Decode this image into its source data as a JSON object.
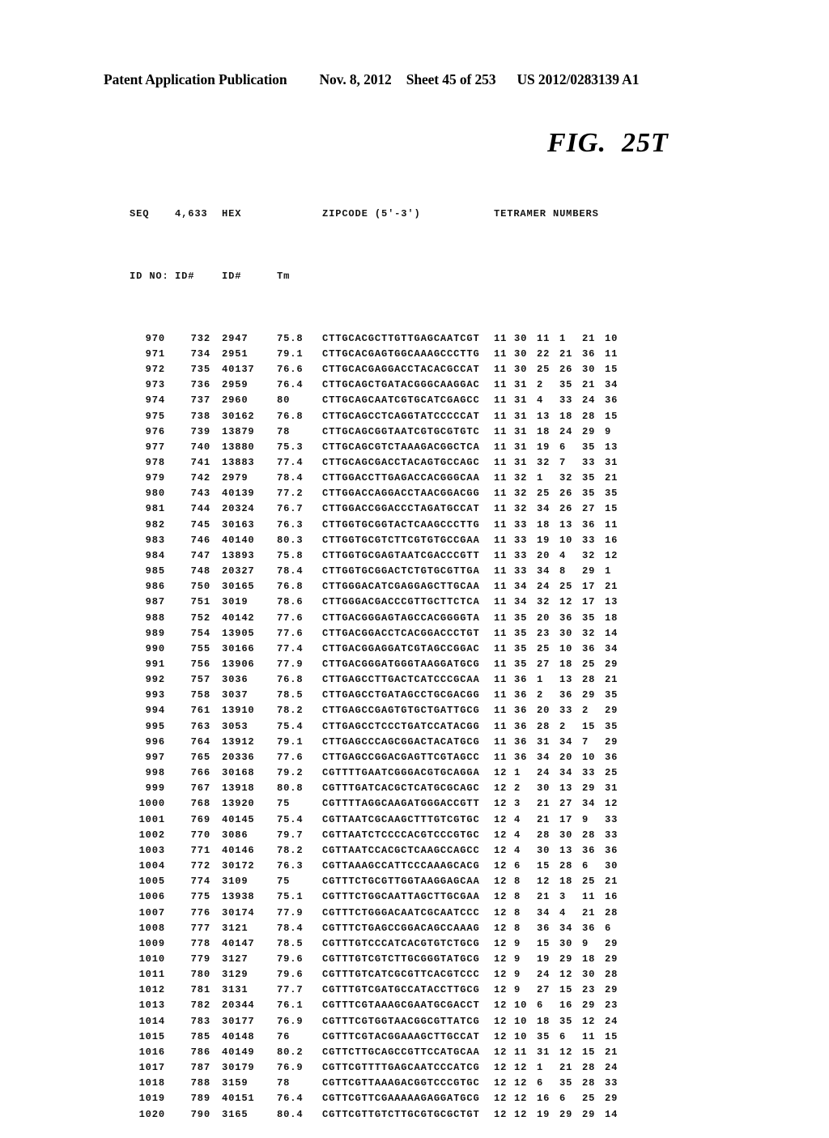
{
  "header": {
    "publication": "Patent Application Publication",
    "date": "Nov. 8, 2012",
    "sheet": "Sheet 45 of 253",
    "patent_number": "US 2012/0283139 A1"
  },
  "figure": {
    "label": "FIG.  25T"
  },
  "table": {
    "header_line_1": {
      "seq": "SEQ",
      "id4633": "4,633",
      "hex": "HEX",
      "tm": "",
      "zipcode": "ZIPCODE (5'-3')",
      "tetramer": "TETRAMER NUMBERS"
    },
    "header_line_2": {
      "seq": "ID NO:",
      "id4633": "ID#",
      "hex": "ID#",
      "tm": "Tm"
    },
    "rows": [
      {
        "seq": "970",
        "id": "732",
        "hex": "2947",
        "tm": "75.8",
        "zip": "CTTGCACGCTTGTTGAGCAATCGT",
        "t": [
          "11",
          "30",
          "11",
          "1",
          "21",
          "10"
        ]
      },
      {
        "seq": "971",
        "id": "734",
        "hex": "2951",
        "tm": "79.1",
        "zip": "CTTGCACGAGTGGCAAAGCCCTTG",
        "t": [
          "11",
          "30",
          "22",
          "21",
          "36",
          "11"
        ]
      },
      {
        "seq": "972",
        "id": "735",
        "hex": "40137",
        "tm": "76.6",
        "zip": "CTTGCACGAGGACCTACACGCCAT",
        "t": [
          "11",
          "30",
          "25",
          "26",
          "30",
          "15"
        ]
      },
      {
        "seq": "973",
        "id": "736",
        "hex": "2959",
        "tm": "76.4",
        "zip": "CTTGCAGCTGATACGGGCAAGGAC",
        "t": [
          "11",
          "31",
          "2",
          "35",
          "21",
          "34"
        ]
      },
      {
        "seq": "974",
        "id": "737",
        "hex": "2960",
        "tm": "80",
        "zip": "CTTGCAGCAATCGTGCATCGAGCC",
        "t": [
          "11",
          "31",
          "4",
          "33",
          "24",
          "36"
        ]
      },
      {
        "seq": "975",
        "id": "738",
        "hex": "30162",
        "tm": "76.8",
        "zip": "CTTGCAGCCTCAGGTATCCCCCAT",
        "t": [
          "11",
          "31",
          "13",
          "18",
          "28",
          "15"
        ]
      },
      {
        "seq": "976",
        "id": "739",
        "hex": "13879",
        "tm": "78",
        "zip": "CTTGCAGCGGTAATCGTGCGTGTC",
        "t": [
          "11",
          "31",
          "18",
          "24",
          "29",
          "9"
        ]
      },
      {
        "seq": "977",
        "id": "740",
        "hex": "13880",
        "tm": "75.3",
        "zip": "CTTGCAGCGTCTAAAGACGGCTCA",
        "t": [
          "11",
          "31",
          "19",
          "6",
          "35",
          "13"
        ]
      },
      {
        "seq": "978",
        "id": "741",
        "hex": "13883",
        "tm": "77.4",
        "zip": "CTTGCAGCGACCTACAGTGCCAGC",
        "t": [
          "11",
          "31",
          "32",
          "7",
          "33",
          "31"
        ]
      },
      {
        "seq": "979",
        "id": "742",
        "hex": "2979",
        "tm": "78.4",
        "zip": "CTTGGACCTTGAGACCACGGGCAA",
        "t": [
          "11",
          "32",
          "1",
          "32",
          "35",
          "21"
        ]
      },
      {
        "seq": "980",
        "id": "743",
        "hex": "40139",
        "tm": "77.2",
        "zip": "CTTGGACCAGGACCTAACGGACGG",
        "t": [
          "11",
          "32",
          "25",
          "26",
          "35",
          "35"
        ]
      },
      {
        "seq": "981",
        "id": "744",
        "hex": "20324",
        "tm": "76.7",
        "zip": "CTTGGACCGGACCCTAGATGCCAT",
        "t": [
          "11",
          "32",
          "34",
          "26",
          "27",
          "15"
        ]
      },
      {
        "seq": "982",
        "id": "745",
        "hex": "30163",
        "tm": "76.3",
        "zip": "CTTGGTGCGGTACTCAAGCCCTTG",
        "t": [
          "11",
          "33",
          "18",
          "13",
          "36",
          "11"
        ]
      },
      {
        "seq": "983",
        "id": "746",
        "hex": "40140",
        "tm": "80.3",
        "zip": "CTTGGTGCGTCTTCGTGTGCCGAA",
        "t": [
          "11",
          "33",
          "19",
          "10",
          "33",
          "16"
        ]
      },
      {
        "seq": "984",
        "id": "747",
        "hex": "13893",
        "tm": "75.8",
        "zip": "CTTGGTGCGAGTAATCGACCCGTT",
        "t": [
          "11",
          "33",
          "20",
          "4",
          "32",
          "12"
        ]
      },
      {
        "seq": "985",
        "id": "748",
        "hex": "20327",
        "tm": "78.4",
        "zip": "CTTGGTGCGGACTCTGTGCGTTGA",
        "t": [
          "11",
          "33",
          "34",
          "8",
          "29",
          "1"
        ]
      },
      {
        "seq": "986",
        "id": "750",
        "hex": "30165",
        "tm": "76.8",
        "zip": "CTTGGGACATCGAGGAGCTTGCAA",
        "t": [
          "11",
          "34",
          "24",
          "25",
          "17",
          "21"
        ]
      },
      {
        "seq": "987",
        "id": "751",
        "hex": "3019",
        "tm": "78.6",
        "zip": "CTTGGGACGACCCGTTGCTTCTCA",
        "t": [
          "11",
          "34",
          "32",
          "12",
          "17",
          "13"
        ]
      },
      {
        "seq": "988",
        "id": "752",
        "hex": "40142",
        "tm": "77.6",
        "zip": "CTTGACGGGAGTAGCCACGGGGTA",
        "t": [
          "11",
          "35",
          "20",
          "36",
          "35",
          "18"
        ]
      },
      {
        "seq": "989",
        "id": "754",
        "hex": "13905",
        "tm": "77.6",
        "zip": "CTTGACGGACCTCACGGACCCTGT",
        "t": [
          "11",
          "35",
          "23",
          "30",
          "32",
          "14"
        ]
      },
      {
        "seq": "990",
        "id": "755",
        "hex": "30166",
        "tm": "77.4",
        "zip": "CTTGACGGAGGATCGTAGCCGGAC",
        "t": [
          "11",
          "35",
          "25",
          "10",
          "36",
          "34"
        ]
      },
      {
        "seq": "991",
        "id": "756",
        "hex": "13906",
        "tm": "77.9",
        "zip": "CTTGACGGGATGGGTAAGGATGCG",
        "t": [
          "11",
          "35",
          "27",
          "18",
          "25",
          "29"
        ]
      },
      {
        "seq": "992",
        "id": "757",
        "hex": "3036",
        "tm": "76.8",
        "zip": "CTTGAGCCTTGACTCATCCCGCAA",
        "t": [
          "11",
          "36",
          "1",
          "13",
          "28",
          "21"
        ]
      },
      {
        "seq": "993",
        "id": "758",
        "hex": "3037",
        "tm": "78.5",
        "zip": "CTTGAGCCTGATAGCCTGCGACGG",
        "t": [
          "11",
          "36",
          "2",
          "36",
          "29",
          "35"
        ]
      },
      {
        "seq": "994",
        "id": "761",
        "hex": "13910",
        "tm": "78.2",
        "zip": "CTTGAGCCGAGTGTGCTGATTGCG",
        "t": [
          "11",
          "36",
          "20",
          "33",
          "2",
          "29"
        ]
      },
      {
        "seq": "995",
        "id": "763",
        "hex": "3053",
        "tm": "75.4",
        "zip": "CTTGAGCCTCCCTGATCCATACGG",
        "t": [
          "11",
          "36",
          "28",
          "2",
          "15",
          "35"
        ]
      },
      {
        "seq": "996",
        "id": "764",
        "hex": "13912",
        "tm": "79.1",
        "zip": "CTTGAGCCCAGCGGACTACATGCG",
        "t": [
          "11",
          "36",
          "31",
          "34",
          "7",
          "29"
        ]
      },
      {
        "seq": "997",
        "id": "765",
        "hex": "20336",
        "tm": "77.6",
        "zip": "CTTGAGCCGGACGAGTTCGTAGCC",
        "t": [
          "11",
          "36",
          "34",
          "20",
          "10",
          "36"
        ]
      },
      {
        "seq": "998",
        "id": "766",
        "hex": "30168",
        "tm": "79.2",
        "zip": "CGTTTTGAATCGGGACGTGCAGGA",
        "t": [
          "12",
          "1",
          "24",
          "34",
          "33",
          "25"
        ]
      },
      {
        "seq": "999",
        "id": "767",
        "hex": "13918",
        "tm": "80.8",
        "zip": "CGTTTGATCACGCTCATGCGCAGC",
        "t": [
          "12",
          "2",
          "30",
          "13",
          "29",
          "31"
        ]
      },
      {
        "seq": "1000",
        "id": "768",
        "hex": "13920",
        "tm": "75",
        "zip": "CGTTTTAGGCAAGATGGGACCGTT",
        "t": [
          "12",
          "3",
          "21",
          "27",
          "34",
          "12"
        ]
      },
      {
        "seq": "1001",
        "id": "769",
        "hex": "40145",
        "tm": "75.4",
        "zip": "CGTTAATCGCAAGCTTTGTCGTGC",
        "t": [
          "12",
          "4",
          "21",
          "17",
          "9",
          "33"
        ]
      },
      {
        "seq": "1002",
        "id": "770",
        "hex": "3086",
        "tm": "79.7",
        "zip": "CGTTAATCTCCCCACGTCCCGTGC",
        "t": [
          "12",
          "4",
          "28",
          "30",
          "28",
          "33"
        ]
      },
      {
        "seq": "1003",
        "id": "771",
        "hex": "40146",
        "tm": "78.2",
        "zip": "CGTTAATCCACGCTCAAGCCAGCC",
        "t": [
          "12",
          "4",
          "30",
          "13",
          "36",
          "36"
        ]
      },
      {
        "seq": "1004",
        "id": "772",
        "hex": "30172",
        "tm": "76.3",
        "zip": "CGTTAAAGCCATTCCCAAAGCACG",
        "t": [
          "12",
          "6",
          "15",
          "28",
          "6",
          "30"
        ]
      },
      {
        "seq": "1005",
        "id": "774",
        "hex": "3109",
        "tm": "75",
        "zip": "CGTTTCTGCGTTGGTAAGGAGCAA",
        "t": [
          "12",
          "8",
          "12",
          "18",
          "25",
          "21"
        ]
      },
      {
        "seq": "1006",
        "id": "775",
        "hex": "13938",
        "tm": "75.1",
        "zip": "CGTTTCTGGCAATTAGCTTGCGAA",
        "t": [
          "12",
          "8",
          "21",
          "3",
          "11",
          "16"
        ]
      },
      {
        "seq": "1007",
        "id": "776",
        "hex": "30174",
        "tm": "77.9",
        "zip": "CGTTTCTGGGACAATCGCAATCCC",
        "t": [
          "12",
          "8",
          "34",
          "4",
          "21",
          "28"
        ]
      },
      {
        "seq": "1008",
        "id": "777",
        "hex": "3121",
        "tm": "78.4",
        "zip": "CGTTTCTGAGCCGGACAGCCAAAG",
        "t": [
          "12",
          "8",
          "36",
          "34",
          "36",
          "6"
        ]
      },
      {
        "seq": "1009",
        "id": "778",
        "hex": "40147",
        "tm": "78.5",
        "zip": "CGTTTGTCCCATCACGTGTCTGCG",
        "t": [
          "12",
          "9",
          "15",
          "30",
          "9",
          "29"
        ]
      },
      {
        "seq": "1010",
        "id": "779",
        "hex": "3127",
        "tm": "79.6",
        "zip": "CGTTTGTCGTCTTGCGGGTATGCG",
        "t": [
          "12",
          "9",
          "19",
          "29",
          "18",
          "29"
        ]
      },
      {
        "seq": "1011",
        "id": "780",
        "hex": "3129",
        "tm": "79.6",
        "zip": "CGTTTGTCATCGCGTTCACGTCCC",
        "t": [
          "12",
          "9",
          "24",
          "12",
          "30",
          "28"
        ]
      },
      {
        "seq": "1012",
        "id": "781",
        "hex": "3131",
        "tm": "77.7",
        "zip": "CGTTTGTCGATGCCATACCTTGCG",
        "t": [
          "12",
          "9",
          "27",
          "15",
          "23",
          "29"
        ]
      },
      {
        "seq": "1013",
        "id": "782",
        "hex": "20344",
        "tm": "76.1",
        "zip": "CGTTTCGTAAAGCGAATGCGACCT",
        "t": [
          "12",
          "10",
          "6",
          "16",
          "29",
          "23"
        ]
      },
      {
        "seq": "1014",
        "id": "783",
        "hex": "30177",
        "tm": "76.9",
        "zip": "CGTTTCGTGGTAACGGCGTTATCG",
        "t": [
          "12",
          "10",
          "18",
          "35",
          "12",
          "24"
        ]
      },
      {
        "seq": "1015",
        "id": "785",
        "hex": "40148",
        "tm": "76",
        "zip": "CGTTTCGTACGGAAAGCTTGCCAT",
        "t": [
          "12",
          "10",
          "35",
          "6",
          "11",
          "15"
        ]
      },
      {
        "seq": "1016",
        "id": "786",
        "hex": "40149",
        "tm": "80.2",
        "zip": "CGTTCTTGCAGCCGTTCCATGCAA",
        "t": [
          "12",
          "11",
          "31",
          "12",
          "15",
          "21"
        ]
      },
      {
        "seq": "1017",
        "id": "787",
        "hex": "30179",
        "tm": "76.9",
        "zip": "CGTTCGTTTTGAGCAATCCCATCG",
        "t": [
          "12",
          "12",
          "1",
          "21",
          "28",
          "24"
        ]
      },
      {
        "seq": "1018",
        "id": "788",
        "hex": "3159",
        "tm": "78",
        "zip": "CGTTCGTTAAAGACGGTCCCGTGC",
        "t": [
          "12",
          "12",
          "6",
          "35",
          "28",
          "33"
        ]
      },
      {
        "seq": "1019",
        "id": "789",
        "hex": "40151",
        "tm": "76.4",
        "zip": "CGTTCGTTCGAAAAAGAGGATGCG",
        "t": [
          "12",
          "12",
          "16",
          "6",
          "25",
          "29"
        ]
      },
      {
        "seq": "1020",
        "id": "790",
        "hex": "3165",
        "tm": "80.4",
        "zip": "CGTTCGTTGTCTTGCGTGCGCTGT",
        "t": [
          "12",
          "12",
          "19",
          "29",
          "29",
          "14"
        ]
      }
    ]
  }
}
